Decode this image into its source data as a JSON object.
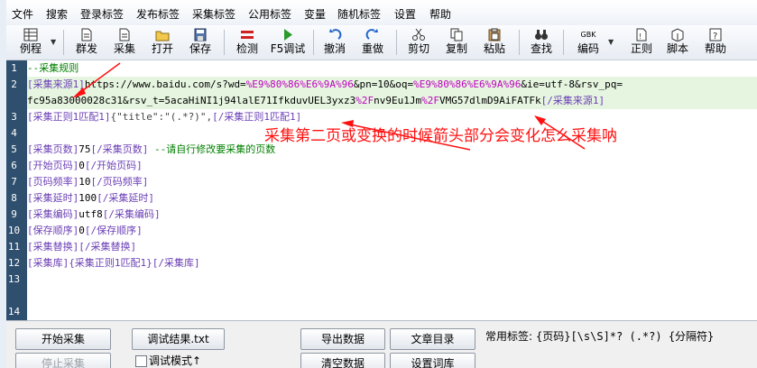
{
  "menu": [
    "文件",
    "搜索",
    "登录标签",
    "发布标签",
    "采集标签",
    "公用标签",
    "变量",
    "随机标签",
    "设置",
    "帮助"
  ],
  "toolbar": {
    "example": "例程",
    "mass_publish": "群发",
    "collect": "采集",
    "open": "打开",
    "save": "保存",
    "detect": "检测",
    "f5_debug": "F5调试",
    "undo": "撤消",
    "redo": "重做",
    "cut": "剪切",
    "copy": "复制",
    "paste": "粘贴",
    "find": "查找",
    "encoding_badge": "GBK",
    "encoding": "编码",
    "regex": "正则",
    "script": "脚本",
    "help": "帮助"
  },
  "editor": {
    "line_numbers": [
      "1",
      "2",
      "",
      "3",
      "",
      "4",
      "5",
      "6",
      "7",
      "8",
      "9",
      "10",
      "11",
      "12",
      "13",
      "14"
    ],
    "line1": "--采集规则",
    "line2_open_tag": "[采集来源1]",
    "line2_url_a": "https://www.baidu.com/s?wd=",
    "line2_url_b": "%E9%80%86%E6%9A%96",
    "line2_url_c": "&pn=10&oq=",
    "line2_url_d": "%E9%80%86%E6%9A%96",
    "line2_url_e": "&ie=utf-8&rsv_pq=",
    "line2b_text": "fc95a83000028c31&rsv_t=5acaHiNI1j94lalE71IfkduvUEL3yxz3",
    "line2b_pct": "%2F",
    "line2b_text2": "nv9Eu1Jm",
    "line2b_pct2": "%2F",
    "line2b_text3": "VMG57dlmD9AiFATFk",
    "line2b_close_tag": "[/采集来源1]",
    "line3_open": "[采集正则1匹配1]",
    "line3_body": "{\"title\":\"(.*?)\",",
    "line3_close": "[/采集正则1匹配1]",
    "line5_open": "[采集页数]",
    "line5_val": "75",
    "line5_close": "[/采集页数]",
    "line5_comment": " --请自行修改要采集的页数",
    "line6_open": "[开始页码]",
    "line6_val": "0",
    "line6_close": "[/开始页码]",
    "line7_open": "[页码频率]",
    "line7_val": "10",
    "line7_close": "[/页码频率]",
    "line8_open": "[采集延时]",
    "line8_val": "100",
    "line8_close": "[/采集延时]",
    "line9_open": "[采集编码]",
    "line9_val": "utf8",
    "line9_close": "[/采集编码]",
    "line10_open": "[保存顺序]",
    "line10_val": "0",
    "line10_close": "[/保存顺序]",
    "line11_open": "[采集替换]",
    "line11_close": "[/采集替换]",
    "line12_open": "[采集库]",
    "line12_val": "{采集正则1匹配1}",
    "line12_close": "[/采集库]",
    "annotation": "采集第二页或变换的时候箭头部分会变化怎么采集呐"
  },
  "bottom": {
    "start_collect": "开始采集",
    "stop_collect": "停止采集",
    "debug_result": "调试结果.txt",
    "debug_mode": "调试模式↑",
    "export_data": "导出数据",
    "clear_data": "清空数据",
    "article_dir": "文章目录",
    "set_lexicon": "设置词库",
    "common_label": "常用标签:",
    "common_tags": "{页码}[\\s\\S]*?  (.*?)  {分隔符}"
  },
  "colors": {
    "gutter": "#2f4f6e",
    "tag": "#6b3fb5",
    "comment": "#008000",
    "annotation": "#ff1010",
    "highlight": "#e6f5e0"
  }
}
